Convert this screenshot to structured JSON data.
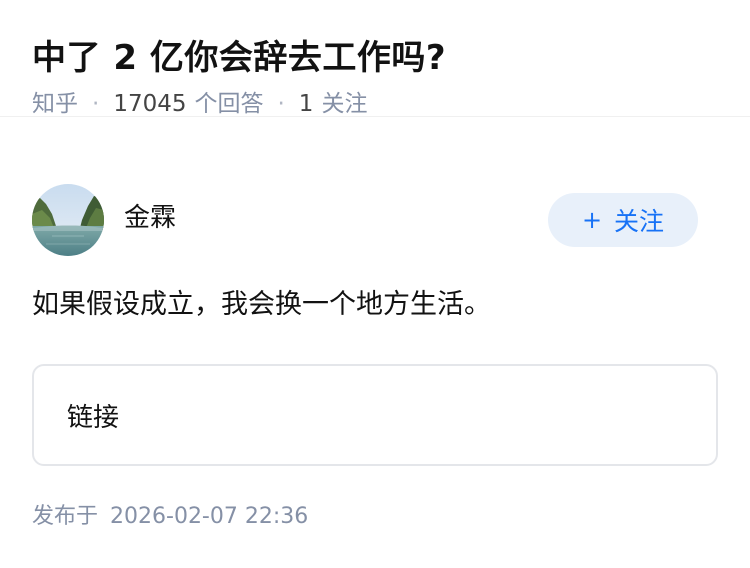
{
  "question": {
    "title": "中了 2 亿你会辞去工作吗?",
    "source": "知乎",
    "answers_count": "17045",
    "answers_label": "个回答",
    "followers_count": "1",
    "followers_label": "关注"
  },
  "author": {
    "name": "金霖",
    "follow_plus": "+",
    "follow_label": "关注"
  },
  "answer": {
    "text": "如果假设成立，我会换一个地方生活。",
    "link_label": "链接"
  },
  "footer": {
    "published_label": "发布于",
    "published_time": "2026-02-07 22:36"
  },
  "colors": {
    "accent": "#1772f6",
    "meta": "#8590a6",
    "follow_bg": "#e8f0fa"
  }
}
